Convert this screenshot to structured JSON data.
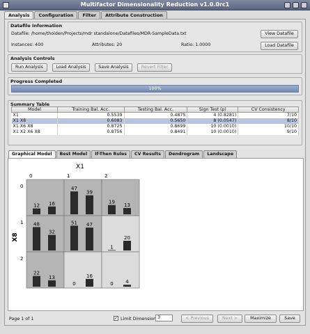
{
  "window": {
    "title": "Multifactor Dimensionality Reduction v1.0.0rc1"
  },
  "main_tabs": [
    {
      "label": "Analysis",
      "active": true
    },
    {
      "label": "Configuration",
      "active": false
    },
    {
      "label": "Filter",
      "active": false
    },
    {
      "label": "Attribute Construction",
      "active": false
    }
  ],
  "datafile": {
    "group_title": "Datafile Information",
    "path": "Datafile: /home/thoiden/Projects/mdr standalone/Datafiles/MDR-SampleData.txt",
    "instances": "Instances: 400",
    "attributes": "Attributes: 20",
    "ratio": "Ratio: 1.0000",
    "view_button": "View Datafile",
    "load_button": "Load Datafile"
  },
  "controls": {
    "group_title": "Analysis Controls",
    "run": "Run Analysis",
    "load": "Load Analysis",
    "save": "Save Analysis",
    "revert": "Revert Filter"
  },
  "progress": {
    "group_title": "Progress Completed",
    "text": "100%",
    "value": 1.0
  },
  "summary": {
    "group_title": "Summary Table",
    "columns": [
      "Model",
      "Training Bal. Acc.",
      "Testing Bal. Acc.",
      "Sign Test (p)",
      "CV Consistency"
    ],
    "rows": [
      {
        "model": "X1",
        "train": "0.5539",
        "test": "0.4875",
        "sign": "4 (0.8281)",
        "cv": "7/10",
        "selected": false
      },
      {
        "model": "X1 X8",
        "train": "0.6083",
        "test": "0.5650",
        "sign": "8 (0.0547)",
        "cv": "8/10",
        "selected": true
      },
      {
        "model": "X1 X6 X8",
        "train": "0.8725",
        "test": "0.8699",
        "sign": "10 (0.0010)",
        "cv": "10/10",
        "selected": false
      },
      {
        "model": "X1 X2 X6 X8",
        "train": "0.8756",
        "test": "0.8491",
        "sign": "10 (0.0010)",
        "cv": "9/10",
        "selected": false
      }
    ]
  },
  "sub_tabs": [
    {
      "label": "Graphical Model",
      "active": true
    },
    {
      "label": "Best Model",
      "active": false
    },
    {
      "label": "If-Then Rules",
      "active": false
    },
    {
      "label": "CV Results",
      "active": false
    },
    {
      "label": "Dendrogram",
      "active": false
    },
    {
      "label": "Landscape",
      "active": false
    }
  ],
  "model_plot": {
    "x_attr": "X1",
    "y_attr": "X8",
    "x_levels": [
      "0",
      "1",
      "2"
    ],
    "y_levels": [
      "0",
      "1",
      "2"
    ],
    "colors": {
      "high_risk": "#b5b5b5",
      "low_risk": "#dcdcdc",
      "empty": "#ffffff",
      "bar": "#2a2a2a"
    },
    "cells": [
      [
        {
          "risk": "high",
          "a": 12,
          "b": 16
        },
        {
          "risk": "high",
          "a": 47,
          "b": 39
        },
        {
          "risk": "high",
          "a": 19,
          "b": 13
        }
      ],
      [
        {
          "risk": "high",
          "a": 48,
          "b": 32
        },
        {
          "risk": "high",
          "a": 51,
          "b": 47
        },
        {
          "risk": "low",
          "a": 1,
          "b": 20
        }
      ],
      [
        {
          "risk": "high",
          "a": 22,
          "b": 13
        },
        {
          "risk": "low",
          "a": 0,
          "b": 16
        },
        {
          "risk": "low",
          "a": 0,
          "b": 4
        }
      ]
    ]
  },
  "footer": {
    "page": "Page 1 of 1",
    "limit_label": "Limit Dimension",
    "limit_checked": true,
    "limit_value": "3",
    "prev": "< Previous",
    "next": "Next >",
    "maximize": "Maximize",
    "save": "Save"
  }
}
